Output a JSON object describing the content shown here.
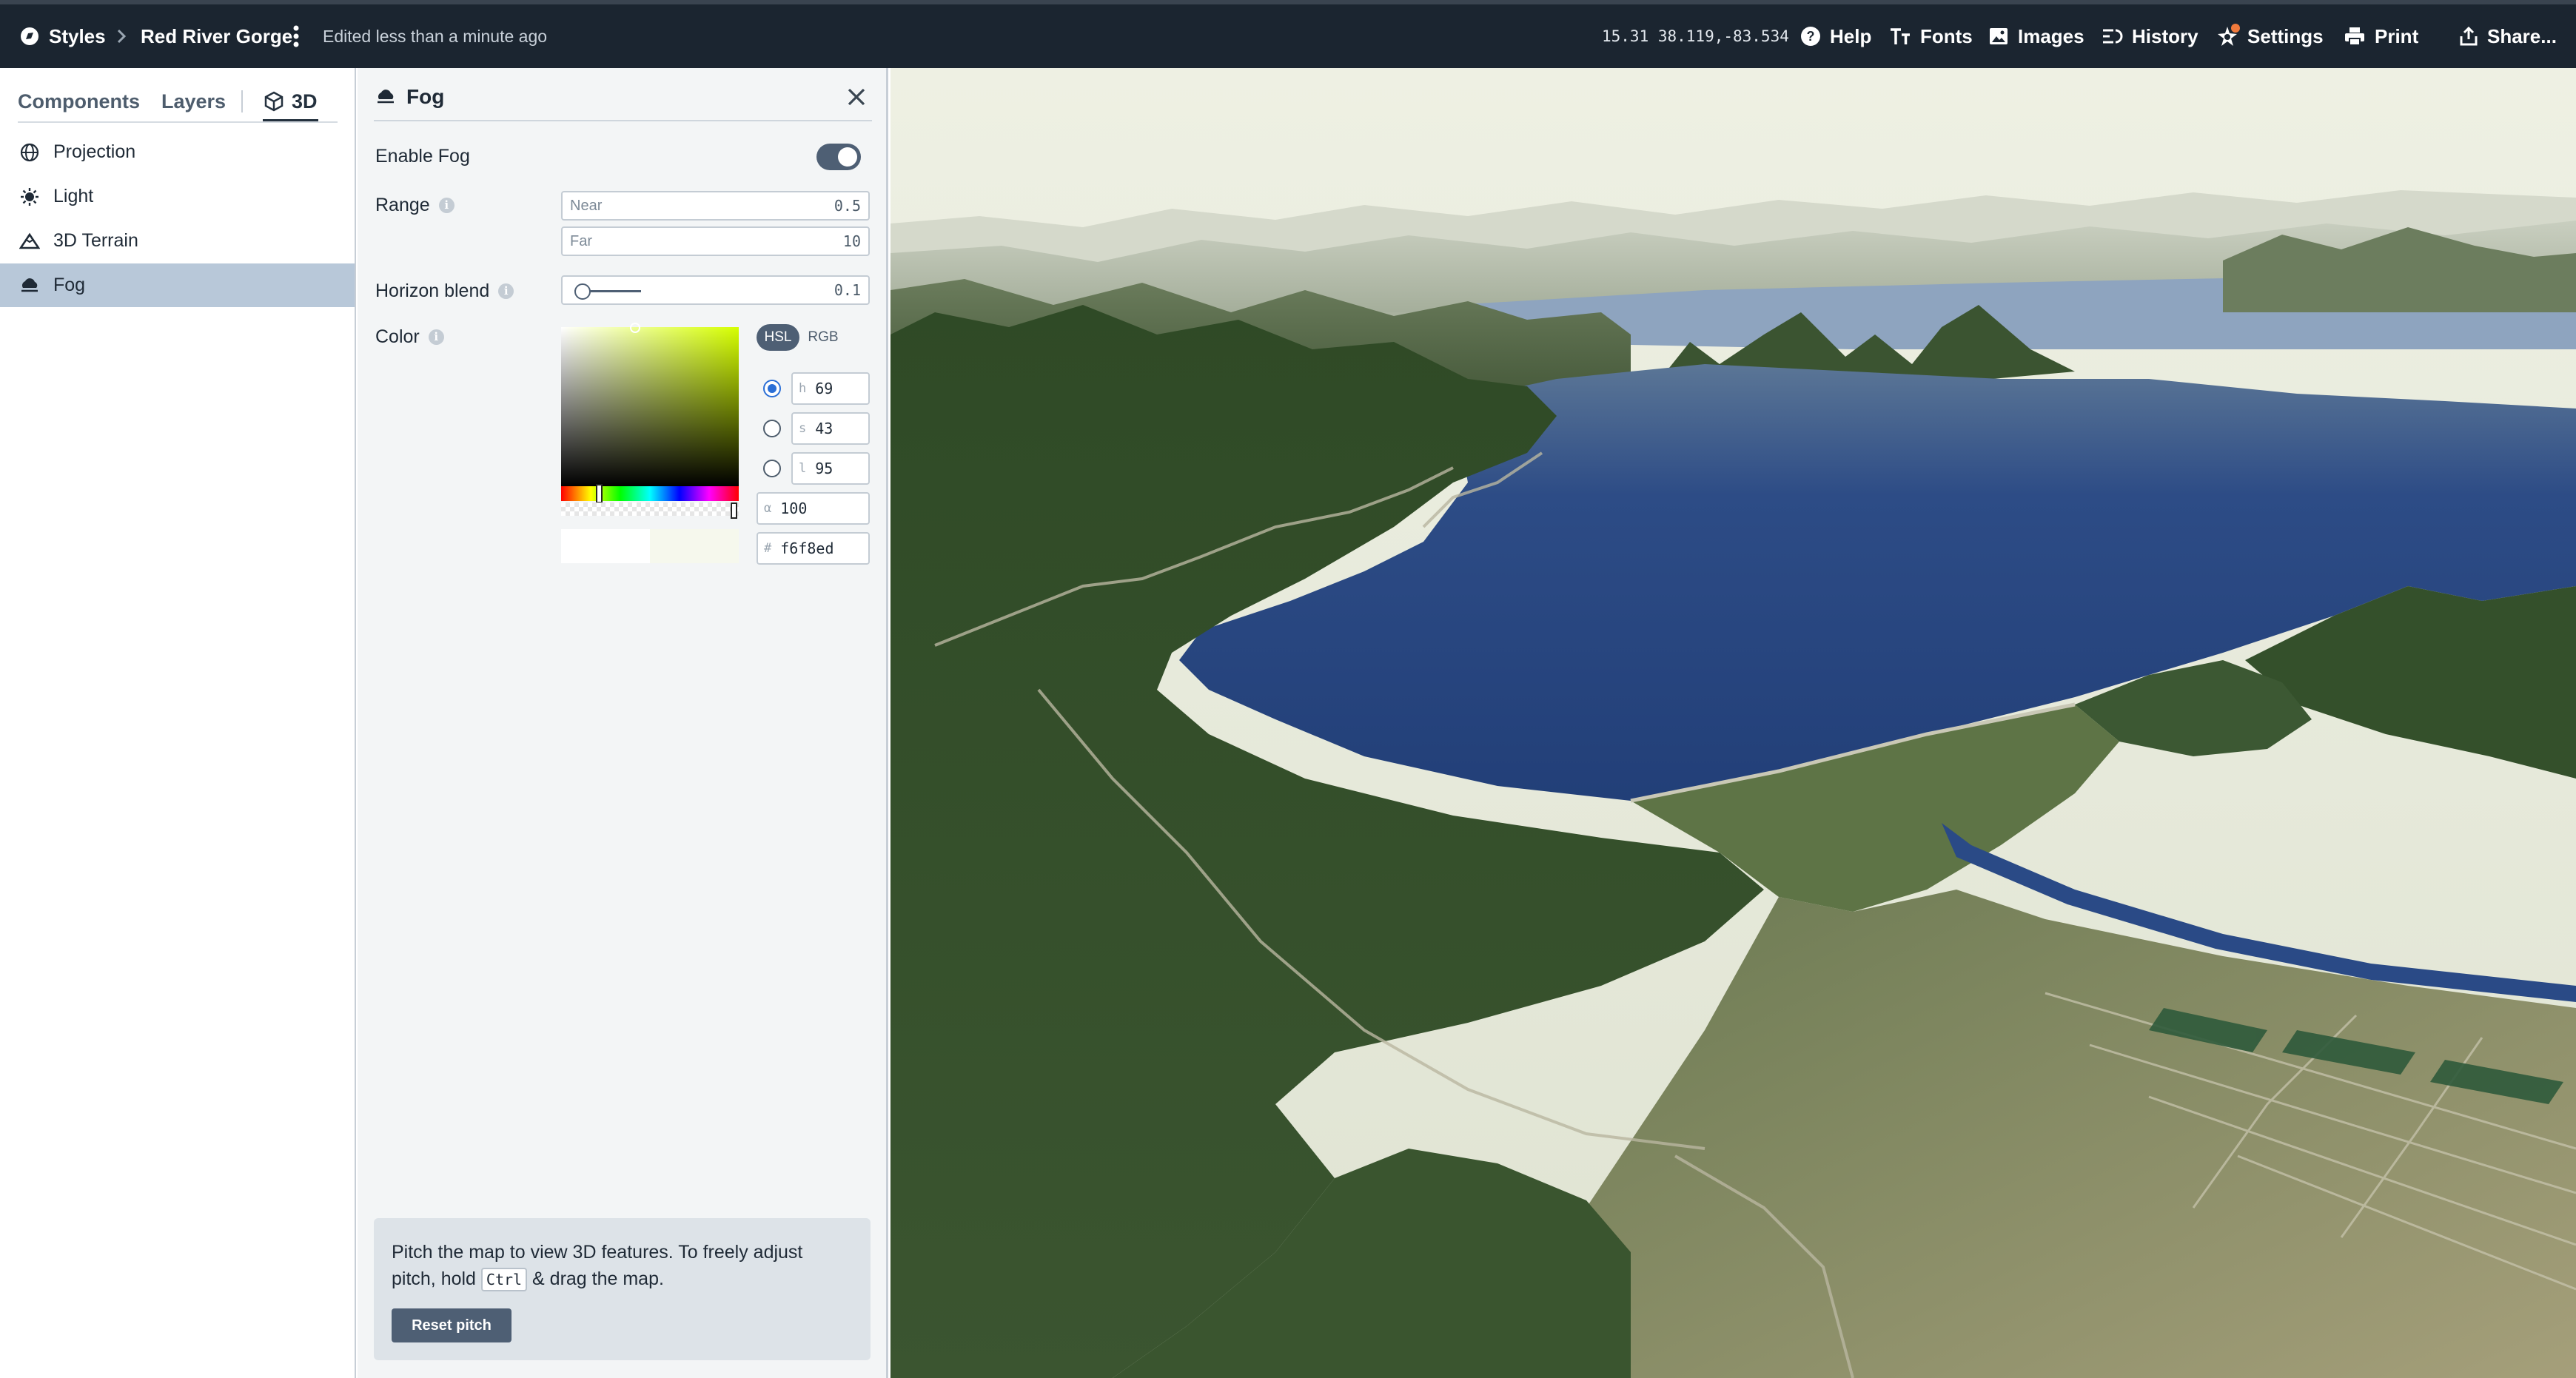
{
  "topbar": {
    "breadcrumb_root": "Styles",
    "style_name": "Red River Gorge",
    "edit_status": "Edited less than a minute ago",
    "map_position": "15.31 38.119,-83.534",
    "help": "Help",
    "fonts": "Fonts",
    "images": "Images",
    "history": "History",
    "settings": "Settings",
    "print": "Print",
    "share": "Share..."
  },
  "sidebar": {
    "tabs": [
      {
        "label": "Components"
      },
      {
        "label": "Layers"
      },
      {
        "label": "3D",
        "active": true
      }
    ],
    "items": [
      {
        "label": "Projection",
        "icon": "globe-icon"
      },
      {
        "label": "Light",
        "icon": "light-icon"
      },
      {
        "label": "3D Terrain",
        "icon": "mountain-icon"
      },
      {
        "label": "Fog",
        "icon": "fog-icon",
        "selected": true
      }
    ]
  },
  "panel": {
    "title": "Fog",
    "enable_fog": {
      "label": "Enable Fog",
      "enabled": true
    },
    "range": {
      "label": "Range",
      "near": {
        "placeholder": "Near",
        "value": "0.5"
      },
      "far": {
        "placeholder": "Far",
        "value": "10"
      }
    },
    "horizon_blend": {
      "label": "Horizon blend",
      "value": "0.1"
    },
    "color": {
      "label": "Color",
      "modes": [
        "HSL",
        "RGB"
      ],
      "active_mode": "HSL",
      "h": {
        "key": "h",
        "value": "69"
      },
      "s": {
        "key": "s",
        "value": "43"
      },
      "l": {
        "key": "l",
        "value": "95"
      },
      "alpha": {
        "key": "α",
        "value": "100"
      },
      "hex": {
        "key": "#",
        "value": "f6f8ed"
      },
      "swatch_previous": "#ffffff",
      "swatch_current": "#f6f8ed"
    },
    "help": {
      "text_before": "Pitch the map to view 3D features. To freely adjust pitch, hold",
      "key": "Ctrl",
      "text_after": "& drag the map.",
      "reset_button": "Reset pitch"
    }
  },
  "colors": {
    "topbar_bg": "#1b2530",
    "selected_row": "#b8c8d9",
    "panel_bg": "#f3f5f6",
    "button": "#4e5f74",
    "lake": "#26457e",
    "forest": "#2e4a25",
    "fog": "#f6f8ed"
  }
}
